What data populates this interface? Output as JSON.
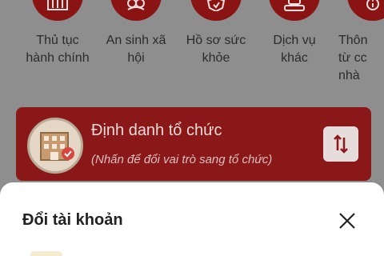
{
  "services": [
    {
      "label_line1": "Thủ tục",
      "label_line2": "hành chính",
      "icon": "document-building-icon"
    },
    {
      "label_line1": "An sinh xã",
      "label_line2": "hội",
      "icon": "community-hands-icon"
    },
    {
      "label_line1": "Hồ sơ sức",
      "label_line2": "khỏe",
      "icon": "health-shield-icon"
    },
    {
      "label_line1": "Dịch vụ",
      "label_line2": "khác",
      "icon": "services-stack-icon"
    },
    {
      "label_line1": "Thôn",
      "label_line2": "từ cc",
      "label_line3": "nhà",
      "icon": "info-icon"
    }
  ],
  "org_card": {
    "title": "Định danh tổ chức",
    "subtitle": "(Nhấn để đổi vai trò sang tổ chức)",
    "avatar_icon": "organization-building-icon",
    "switch_icon": "swap-vertical-icon"
  },
  "sheet": {
    "title": "Đổi tài khoản",
    "close_icon": "close-icon"
  }
}
